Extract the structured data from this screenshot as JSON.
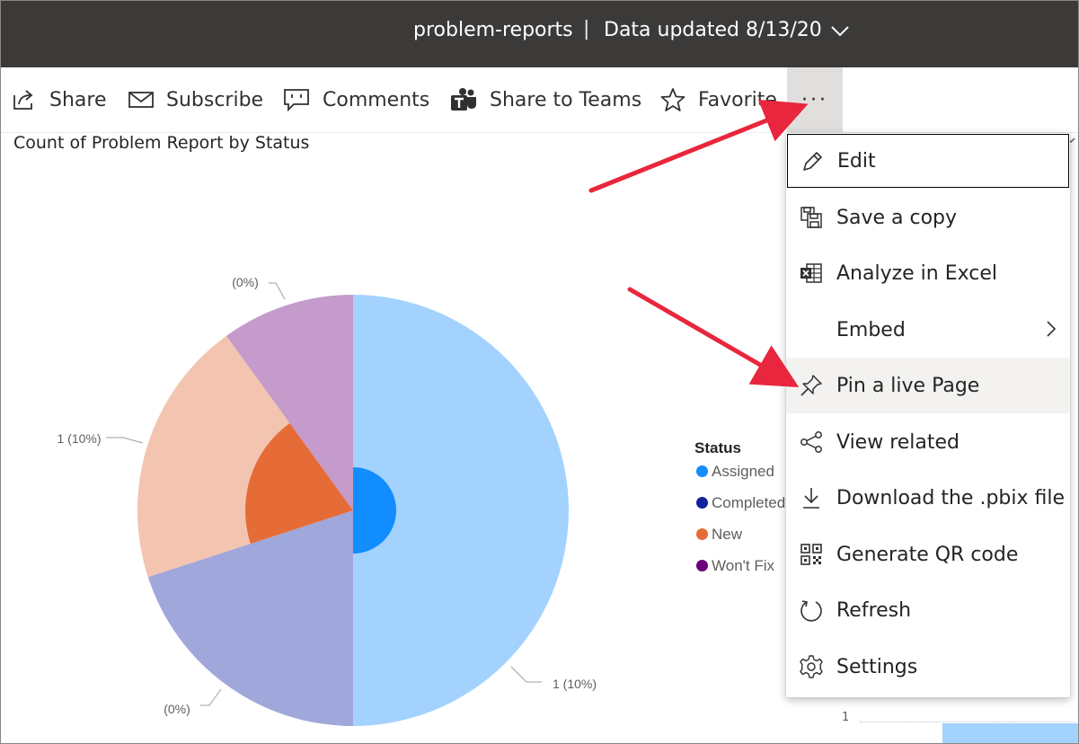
{
  "header": {
    "title": "problem-reports",
    "separator": "|",
    "updated": "Data updated 8/13/20"
  },
  "toolbar": {
    "share": "Share",
    "subscribe": "Subscribe",
    "comments": "Comments",
    "share_teams": "Share to Teams",
    "favorite": "Favorite",
    "more": "···"
  },
  "chart_data": {
    "type": "pie",
    "title": "Count of Problem Report by Status",
    "legend_title": "Status",
    "legend": [
      "Assigned",
      "Completed",
      "New",
      "Won't Fix"
    ],
    "legend_placement": "right",
    "colors": {
      "Assigned": "#118dff",
      "Completed": "#12239e",
      "New": "#e66c37",
      "Won't Fix": "#6b007b"
    },
    "slices": [
      {
        "label": "1 (10%)",
        "value": 50
      },
      {
        "label": "(0%)",
        "value": 20
      },
      {
        "label": "1 (10%)",
        "value": 20
      },
      {
        "label": "(0%)",
        "value": 10
      }
    ],
    "data_labels": [
      "1 (10%)",
      "(0%)",
      "1 (10%)",
      "(0%)"
    ],
    "axis_tick": "1"
  },
  "menu": {
    "items": [
      {
        "label": "Edit",
        "icon": "pencil-icon"
      },
      {
        "label": "Save a copy",
        "icon": "save-copy-icon"
      },
      {
        "label": "Analyze in Excel",
        "icon": "excel-icon"
      },
      {
        "label": "Embed",
        "icon": "chevron-right-icon"
      },
      {
        "label": "Pin a live Page",
        "icon": "pin-icon"
      },
      {
        "label": "View related",
        "icon": "share-nodes-icon"
      },
      {
        "label": "Download the .pbix file",
        "icon": "download-icon"
      },
      {
        "label": "Generate QR code",
        "icon": "qr-code-icon"
      },
      {
        "label": "Refresh",
        "icon": "refresh-icon"
      },
      {
        "label": "Settings",
        "icon": "gear-icon"
      }
    ]
  },
  "annotation_color": "#e8263d"
}
